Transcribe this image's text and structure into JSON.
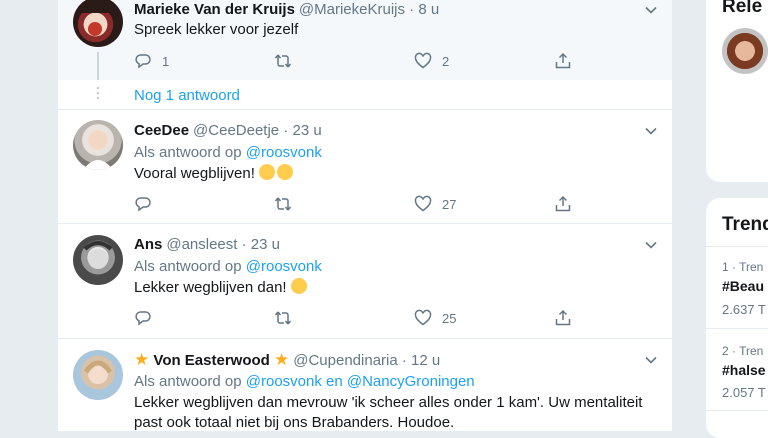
{
  "tweets": [
    {
      "name": "Marieke Van der Kruijs",
      "handle": "@MariekeKruijs",
      "time": "· 8 u",
      "text": "Spreek lekker voor jezelf",
      "replies": "1",
      "retweets": "",
      "likes": "2"
    },
    {
      "name": "CeeDee",
      "handle": "@CeeDeetje",
      "time": "· 23 u",
      "reply_prefix": "Als antwoord op",
      "reply_to": "@roosvonk",
      "text": "Vooral wegblijven!",
      "emojis": [
        "rofl-emoji",
        "joy-emoji"
      ],
      "replies": "",
      "retweets": "",
      "likes": "27"
    },
    {
      "name": "Ans",
      "handle": "@ansleest",
      "time": "· 23 u",
      "reply_prefix": "Als antwoord op",
      "reply_to": "@roosvonk",
      "text": "Lekker wegblijven dan!",
      "emojis": [
        "wink-emoji"
      ],
      "replies": "",
      "retweets": "",
      "likes": "25"
    },
    {
      "name": "Von Easterwood",
      "handle": "@Cupendinaria",
      "time": "· 12 u",
      "reply_prefix": "Als antwoord op",
      "reply_to": "@roosvonk en @NancyGroningen",
      "text": "Lekker wegblijven dan mevrouw 'ik scheer alles onder 1 kam'. Uw mentaliteit past ook totaal niet bij ons Brabanders. Houdoe."
    }
  ],
  "more_replies": "Nog 1 antwoord",
  "sidebar": {
    "relevant_title": "Rele",
    "trends_title": "Trend",
    "trends": [
      {
        "meta": "1 · Tren",
        "tag": "#Beau",
        "count": "2.637 T"
      },
      {
        "meta": "2 · Tren",
        "tag": "#halse",
        "count": "2.057 T"
      }
    ]
  },
  "colors": {
    "accent": "#1da1f2",
    "secondary_text": "#657786",
    "primary_text": "#14171a",
    "star": "#ffad1f"
  }
}
